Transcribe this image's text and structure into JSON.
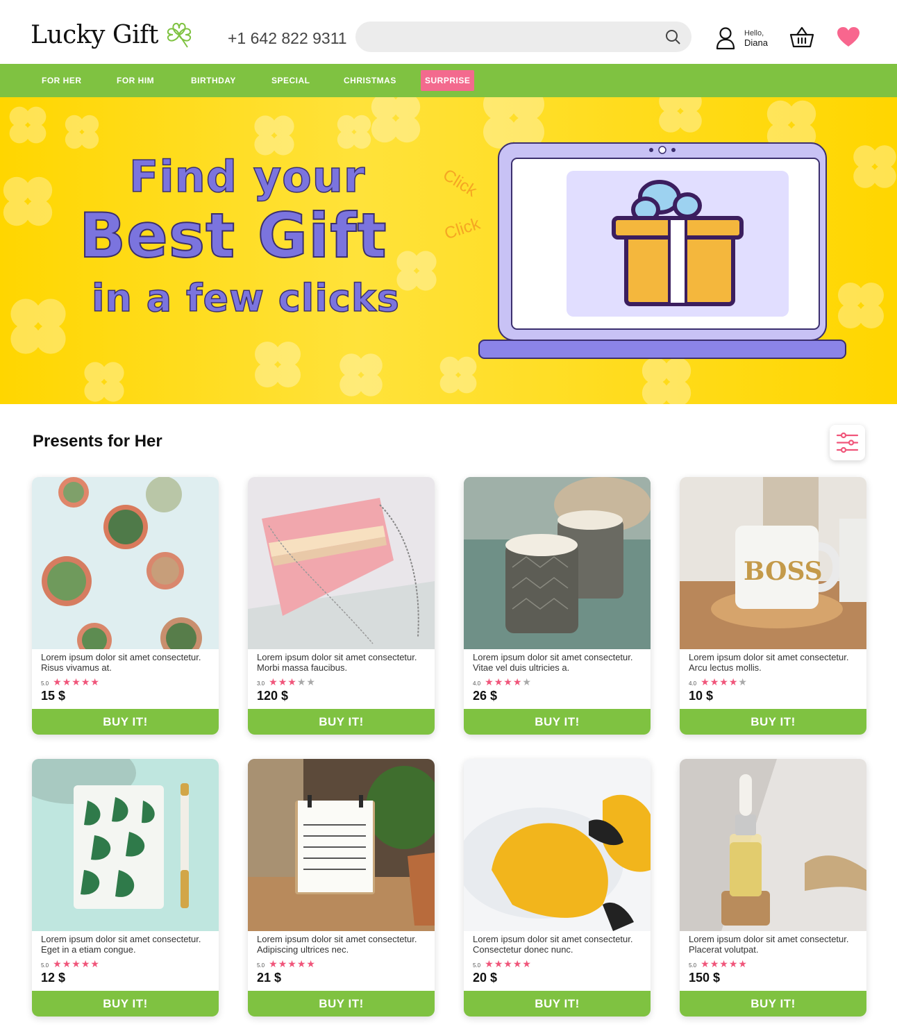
{
  "header": {
    "logo": "Lucky Gift",
    "phone": "+1 642 822 9311",
    "search_placeholder": "",
    "user_greeting": "Hello,",
    "user_name": "Diana",
    "icons": [
      "clover-logo-icon",
      "search-icon",
      "user-icon",
      "basket-icon",
      "heart-icon"
    ]
  },
  "nav": {
    "items": [
      "FOR HER",
      "FOR HIM",
      "BIRTHDAY",
      "SPECIAL",
      "CHRISTMAS",
      "SURPRISE"
    ]
  },
  "hero": {
    "line1": "Find your",
    "line2": "Best Gift",
    "line3": "in a few clicks",
    "click_words": [
      "Click",
      "Click"
    ]
  },
  "section": {
    "title": "Presents for Her"
  },
  "colors": {
    "brand_green": "#7fc241",
    "accent_pink": "#f36a8e",
    "hero_yellow": "#ffd600",
    "hero_purple": "#7b74de",
    "star_pink": "#f0557a"
  },
  "products": [
    {
      "description": "Lorem ipsum dolor sit amet consectetur. Risus vivamus at.",
      "rating_label": "5.0",
      "rating": 5,
      "price": "15 $",
      "button": "BUY IT!"
    },
    {
      "description": "Lorem ipsum dolor sit amet consectetur. Morbi massa faucibus.",
      "rating_label": "3.0",
      "rating": 3,
      "price": "120 $",
      "button": "BUY IT!"
    },
    {
      "description": "Lorem ipsum dolor sit amet consectetur. Vitae vel duis ultricies a.",
      "rating_label": "4.0",
      "rating": 4,
      "price": "26 $",
      "button": "BUY IT!"
    },
    {
      "description": "Lorem ipsum dolor sit amet consectetur. Arcu lectus mollis.",
      "rating_label": "4.0",
      "rating": 4,
      "price": "10 $",
      "button": "BUY IT!"
    },
    {
      "description": "Lorem ipsum dolor sit amet consectetur. Eget in a etiam congue.",
      "rating_label": "5.0",
      "rating": 5,
      "price": "12 $",
      "button": "BUY IT!"
    },
    {
      "description": "Lorem ipsum dolor sit amet consectetur. Adipiscing ultrices nec.",
      "rating_label": "5.0",
      "rating": 5,
      "price": "21 $",
      "button": "BUY IT!"
    },
    {
      "description": "Lorem ipsum dolor sit amet consectetur. Consectetur donec nunc.",
      "rating_label": "5.0",
      "rating": 5,
      "price": "20 $",
      "button": "BUY IT!"
    },
    {
      "description": "Lorem ipsum dolor sit amet consectetur. Placerat volutpat.",
      "rating_label": "5.0",
      "rating": 5,
      "price": "150 $",
      "button": "BUY IT!"
    }
  ]
}
